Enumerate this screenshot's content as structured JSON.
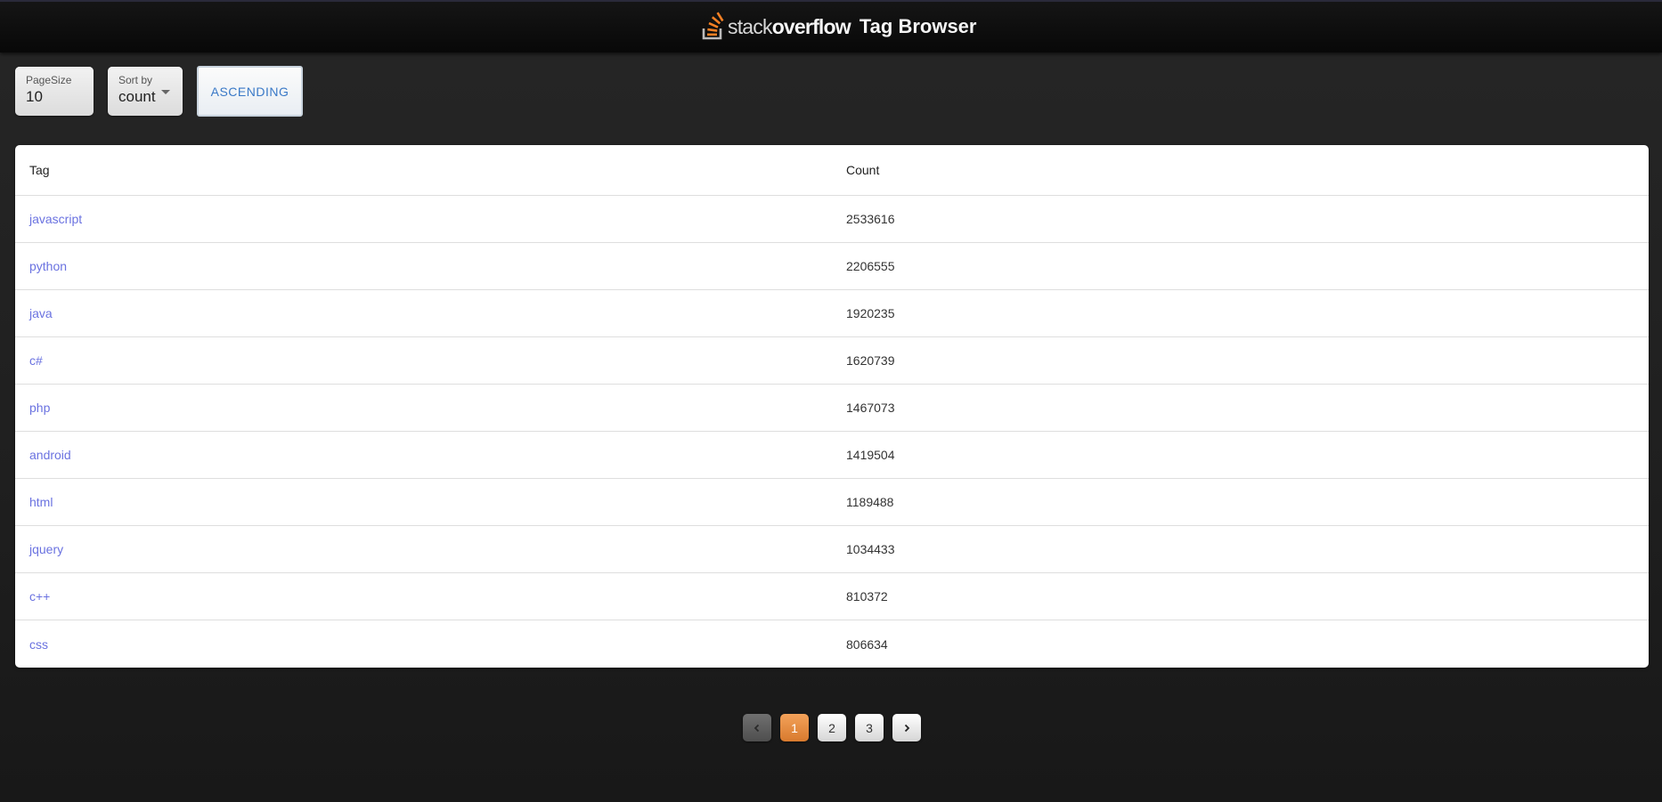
{
  "header": {
    "logo_stack": "stack",
    "logo_overflow": "overflow",
    "title": "Tag Browser",
    "logo_icon": "stackoverflow-logo-icon",
    "logo_color": "#f48024"
  },
  "controls": {
    "page_size": {
      "label": "PageSize",
      "value": "10"
    },
    "sort_by": {
      "label": "Sort by",
      "value": "count",
      "icon": "caret-down-icon"
    },
    "order_button": {
      "label": "ASCENDING",
      "color": "#3a79c7"
    }
  },
  "table": {
    "columns": [
      "Tag",
      "Count"
    ],
    "rows": [
      {
        "tag": "javascript",
        "count": "2533616"
      },
      {
        "tag": "python",
        "count": "2206555"
      },
      {
        "tag": "java",
        "count": "1920235"
      },
      {
        "tag": "c#",
        "count": "1620739"
      },
      {
        "tag": "php",
        "count": "1467073"
      },
      {
        "tag": "android",
        "count": "1419504"
      },
      {
        "tag": "html",
        "count": "1189488"
      },
      {
        "tag": "jquery",
        "count": "1034433"
      },
      {
        "tag": "c++",
        "count": "810372"
      },
      {
        "tag": "css",
        "count": "806634"
      }
    ],
    "link_color": "#6a72e0"
  },
  "pagination": {
    "prev_icon": "chevron-left-icon",
    "next_icon": "chevron-right-icon",
    "pages": [
      "1",
      "2",
      "3"
    ],
    "current_page": "1",
    "active_color": "#e88b3f"
  }
}
